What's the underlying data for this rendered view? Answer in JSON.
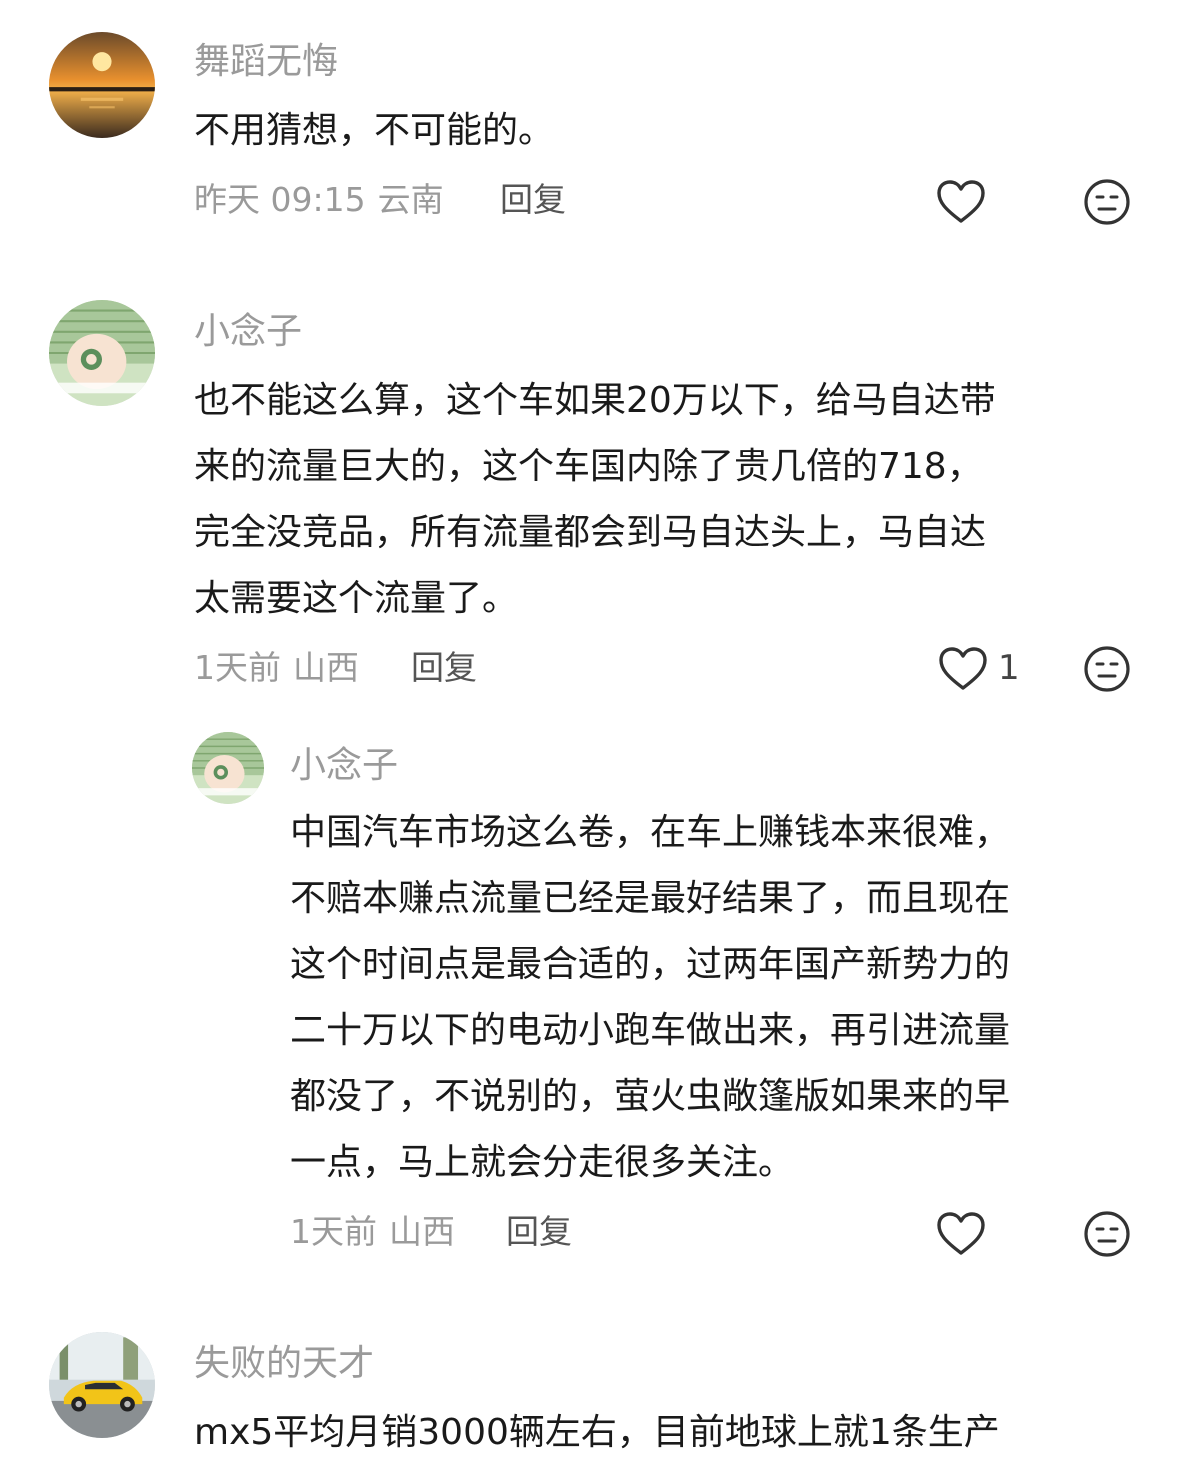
{
  "comments": [
    {
      "author": "舞蹈无悔",
      "text": "不用猜想，不可能的。",
      "time": "昨天 09:15",
      "location": "云南",
      "reply_label": "回复",
      "likes": ""
    },
    {
      "author": "小念子",
      "text": "也不能这么算，这个车如果20万以下，给马自达带\n来的流量巨大的，这个车国内除了贵几倍的718，\n完全没竞品，所有流量都会到马自达头上，马自达\n太需要这个流量了。",
      "time": "1天前",
      "location": "山西",
      "reply_label": "回复",
      "likes": "1"
    },
    {
      "author": "小念子",
      "text": "中国汽车市场这么卷，在车上赚钱本来很难，\n不赔本赚点流量已经是最好结果了，而且现在\n这个时间点是最合适的，过两年国产新势力的\n二十万以下的电动小跑车做出来，再引进流量\n都没了，不说别的，萤火虫敞篷版如果来的早\n一点，马上就会分走很多关注。",
      "time": "1天前",
      "location": "山西",
      "reply_label": "回复",
      "likes": ""
    },
    {
      "author": "失败的天才",
      "text": "mx5平均月销3000辆左右，目前地球上就1条生产"
    }
  ],
  "icons": {
    "like": "heart-outline-icon",
    "dislike": "neutral-face-icon"
  },
  "colors": {
    "text": "#1a1a1a",
    "secondary": "#9a9a9a",
    "icon": "#333333"
  }
}
